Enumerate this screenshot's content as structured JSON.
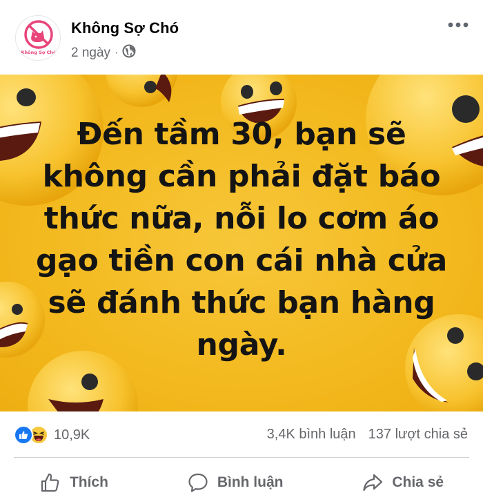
{
  "page": {
    "name": "Không Sợ Chó",
    "time": "2 ngày",
    "separator": "·",
    "avatar_label": "Không Sợ Chó"
  },
  "post": {
    "text": "Đến tầm 30, bạn sẽ\nkhông cần phải đặt báo\nthức nữa, nỗi lo cơm áo\ngạo tiền con cái nhà cửa\nsẽ đánh thức bạn hàng\nngày."
  },
  "stats": {
    "reactions_count": "10,9K",
    "comments": "3,4K bình luận",
    "shares": "137 lượt chia sẻ"
  },
  "actions": {
    "like": "Thích",
    "comment": "Bình luận",
    "share": "Chia sẻ"
  },
  "icons": {
    "more": "more-horizontal-icon",
    "privacy": "globe-icon",
    "like_reaction": "like-reaction-icon",
    "haha_reaction": "haha-reaction-icon",
    "like": "thumbs-up-icon",
    "comment": "comment-bubble-icon",
    "share": "share-arrow-icon"
  },
  "colors": {
    "brand_pink": "#e8457a",
    "image_bg": "#f3b91e",
    "like_blue": "#1877f2",
    "muted": "#65676b"
  }
}
